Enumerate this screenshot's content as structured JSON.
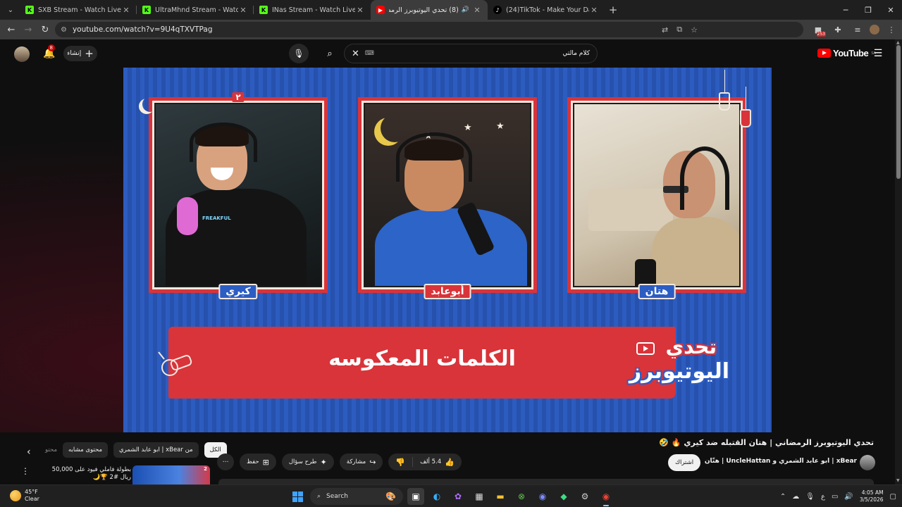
{
  "browser": {
    "tabs": [
      {
        "title": "SXB Stream - Watch Live on Kick",
        "favicon": "kick",
        "active": false
      },
      {
        "title": "UltraMhnd Stream - Watch Live on Kick",
        "favicon": "kick",
        "active": false
      },
      {
        "title": "INas Stream - Watch Live on Kick",
        "favicon": "kick",
        "active": false
      },
      {
        "title": "(8) تحدي اليوتيوبرز الرمضاني",
        "favicon": "youtube",
        "active": true
      },
      {
        "title": "(24)TikTok - Make Your Day",
        "favicon": "tiktok",
        "active": false
      }
    ],
    "url": "youtube.com/watch?v=9U4qTXVTPag",
    "extension_badge": "253"
  },
  "youtube": {
    "logo_text": "YouTube",
    "region": "SA",
    "search_query": "كلام مالتي",
    "search_keyboard_icon": "⌨",
    "create_label": "إنشاء",
    "notification_count": "8"
  },
  "video": {
    "streamers": [
      {
        "name": "هتان",
        "label_color": "#2c5dc3"
      },
      {
        "name": "أبوعابد",
        "label_color": "#d8343a"
      },
      {
        "name": "كيري",
        "label_color": "#2c5dc3",
        "tag": "٢"
      }
    ],
    "banner_text": "الكلمات المعكوسه",
    "logo_line1": "تحدي",
    "logo_line2": "اليوتيوبرز",
    "title": "تحدي اليوتيوبرز الرمضاني | هتان القتبله ضد كيري 🔥 🤣"
  },
  "below": {
    "chips": [
      "الكل",
      "من xBear | ابو عابد الشمري",
      "محتوى مشابه",
      "محتو"
    ],
    "actions": {
      "more": "⋯",
      "save": "حفظ",
      "ask": "طرح سؤال",
      "share": "مشاركة",
      "like_count": "5.4 ألف"
    },
    "subscribe": "اشتراك",
    "channels": "xBear | ابو عابد الشمري و UncleHattan | هتّان",
    "suggestion_text": "بطولة فاملي فيود على 50,000 ريال #2 🏆🌙",
    "suggestion_thumb_num": "2"
  },
  "taskbar": {
    "weather_temp": "45°F",
    "weather_desc": "Clear",
    "search_label": "Search",
    "lang": "ع",
    "time": "4:05 AM",
    "date": "3/5/2026"
  }
}
